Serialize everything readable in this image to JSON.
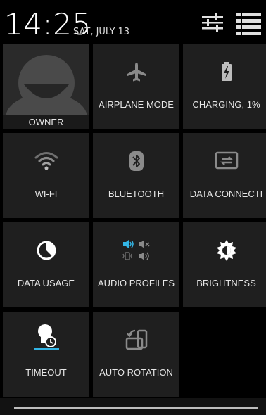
{
  "header": {
    "time": "14:25",
    "date": "SAT, JULY 13"
  },
  "tiles": {
    "owner": {
      "label": "OWNER"
    },
    "airplane": {
      "label": "AIRPLANE MODE"
    },
    "charging": {
      "label": "CHARGING, 1%"
    },
    "wifi": {
      "label": "WI-FI"
    },
    "bluetooth": {
      "label": "BLUETOOTH"
    },
    "data_connection": {
      "label": "DATA CONNECTI"
    },
    "data_usage": {
      "label": "DATA USAGE"
    },
    "audio_profiles": {
      "label": "AUDIO PROFILES"
    },
    "brightness": {
      "label": "BRIGHTNESS"
    },
    "timeout": {
      "label": "TIMEOUT"
    },
    "auto_rotation": {
      "label": "AUTO ROTATION"
    }
  },
  "colors": {
    "tile_bg": "#1f1f1f",
    "accent": "#33b5e5",
    "icon": "#9e9e9e"
  },
  "icons": {
    "settings": "sliders-icon",
    "notifications": "list-icon"
  }
}
